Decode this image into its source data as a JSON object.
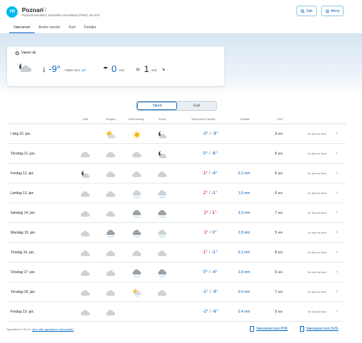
{
  "header": {
    "logo_text": "YR",
    "location_name": "Poznań",
    "star_glyph": "☆",
    "location_sub": "Regionshovedstad, Storpolske voivodskap (Polen), 69 moh.",
    "search_label": "Søk",
    "menu_label": "Meny",
    "tabs": [
      "Værvarsel",
      "Andre varsler",
      "Kart",
      "Detaljer"
    ]
  },
  "now": {
    "title": "Været nå",
    "temperature": "-9°",
    "feels_label": "Føles som",
    "feels_value": "-12°",
    "precip_value": "0",
    "precip_unit": "mm",
    "wind_value": "1",
    "wind_unit": "m/s"
  },
  "view_toggle": {
    "table": "Tabell",
    "graph": "Graf"
  },
  "columns": {
    "natt": "Natt",
    "morgen": "Morgen",
    "ettermiddag": "Ettermiddag",
    "kveld": "Kveld",
    "temp": "Temperatur høy/lav",
    "nedbor": "Nedbør",
    "vind": "Vind"
  },
  "rows": [
    {
      "day": "I dag 10. jan.",
      "icons": [
        "",
        "sun-cloud",
        "sun",
        "moon-cloud"
      ],
      "high": "-3°",
      "low": "-9°",
      "precip": "",
      "wind": "3",
      "high_warm": false
    },
    {
      "day": "Torsdag 11. jan.",
      "icons": [
        "cloud",
        "cloud",
        "cloud",
        "moon-cloud"
      ],
      "high": "0°",
      "low": "-6°",
      "precip": "",
      "wind": "5",
      "high_warm": false
    },
    {
      "day": "Fredag 12. jan.",
      "icons": [
        "moon-cloud",
        "cloud",
        "cloud",
        "cloud"
      ],
      "high": "1°",
      "low": "-4°",
      "precip": "0,2 mm",
      "wind": "6",
      "high_warm": true
    },
    {
      "day": "Lørdag 13. jan.",
      "icons": [
        "cloud",
        "cloud",
        "snow-cloud",
        "snow-cloud"
      ],
      "high": "2°",
      "low": "-1°",
      "precip": "1,6 mm",
      "wind": "6",
      "high_warm": true
    },
    {
      "day": "Søndag 14. jan.",
      "icons": [
        "cloud",
        "cloud",
        "snow-dark",
        "snow-dark"
      ],
      "high": "2°",
      "low": "1°",
      "precip": "3,5 mm",
      "wind": "7",
      "high_warm": true,
      "low_warm": true
    },
    {
      "day": "Mandag 15. jan.",
      "icons": [
        "cloud",
        "snow-dark",
        "snow-dark",
        "snow-cloud"
      ],
      "high": "1°",
      "low": "0°",
      "precip": "2,8 mm",
      "wind": "5",
      "high_warm": true
    },
    {
      "day": "Tirsdag 16. jan.",
      "icons": [
        "cloud",
        "cloud",
        "cloud",
        "cloud"
      ],
      "high": "1°",
      "low": "-1°",
      "precip": "0,3 mm",
      "wind": "8",
      "high_warm": true
    },
    {
      "day": "Onsdag 17. jan.",
      "icons": [
        "cloud",
        "cloud",
        "snow-dark",
        "snow-dark"
      ],
      "high": "0°",
      "low": "-4°",
      "precip": "2,8 mm",
      "wind": "5",
      "high_warm": false
    },
    {
      "day": "Torsdag 18. jan.",
      "icons": [
        "cloud",
        "cloud",
        "sun-snow",
        "cloud"
      ],
      "high": "-1°",
      "low": "-6°",
      "precip": "0,5 mm",
      "wind": "7",
      "high_warm": false
    },
    {
      "day": "Fredag 19. jan.",
      "icons": [
        "cloud",
        "cloud",
        "",
        ""
      ],
      "high": "-2°",
      "low": "-6°",
      "precip": "0,4 mm",
      "wind": "5",
      "high_warm": false
    }
  ],
  "row_link": "Se time for time",
  "wind_unit": "m/s",
  "footer": {
    "updated": "Oppdatert kl. 06:41.",
    "faq_link": "Hvor ofte oppdateres værvarslet?",
    "pdf_link": "Værvarsel som PDF",
    "svg_link": "Værvarsel som SVG"
  },
  "colors": {
    "accent": "#0062b8",
    "warm": "#c60000",
    "logo": "#00b8f1"
  }
}
